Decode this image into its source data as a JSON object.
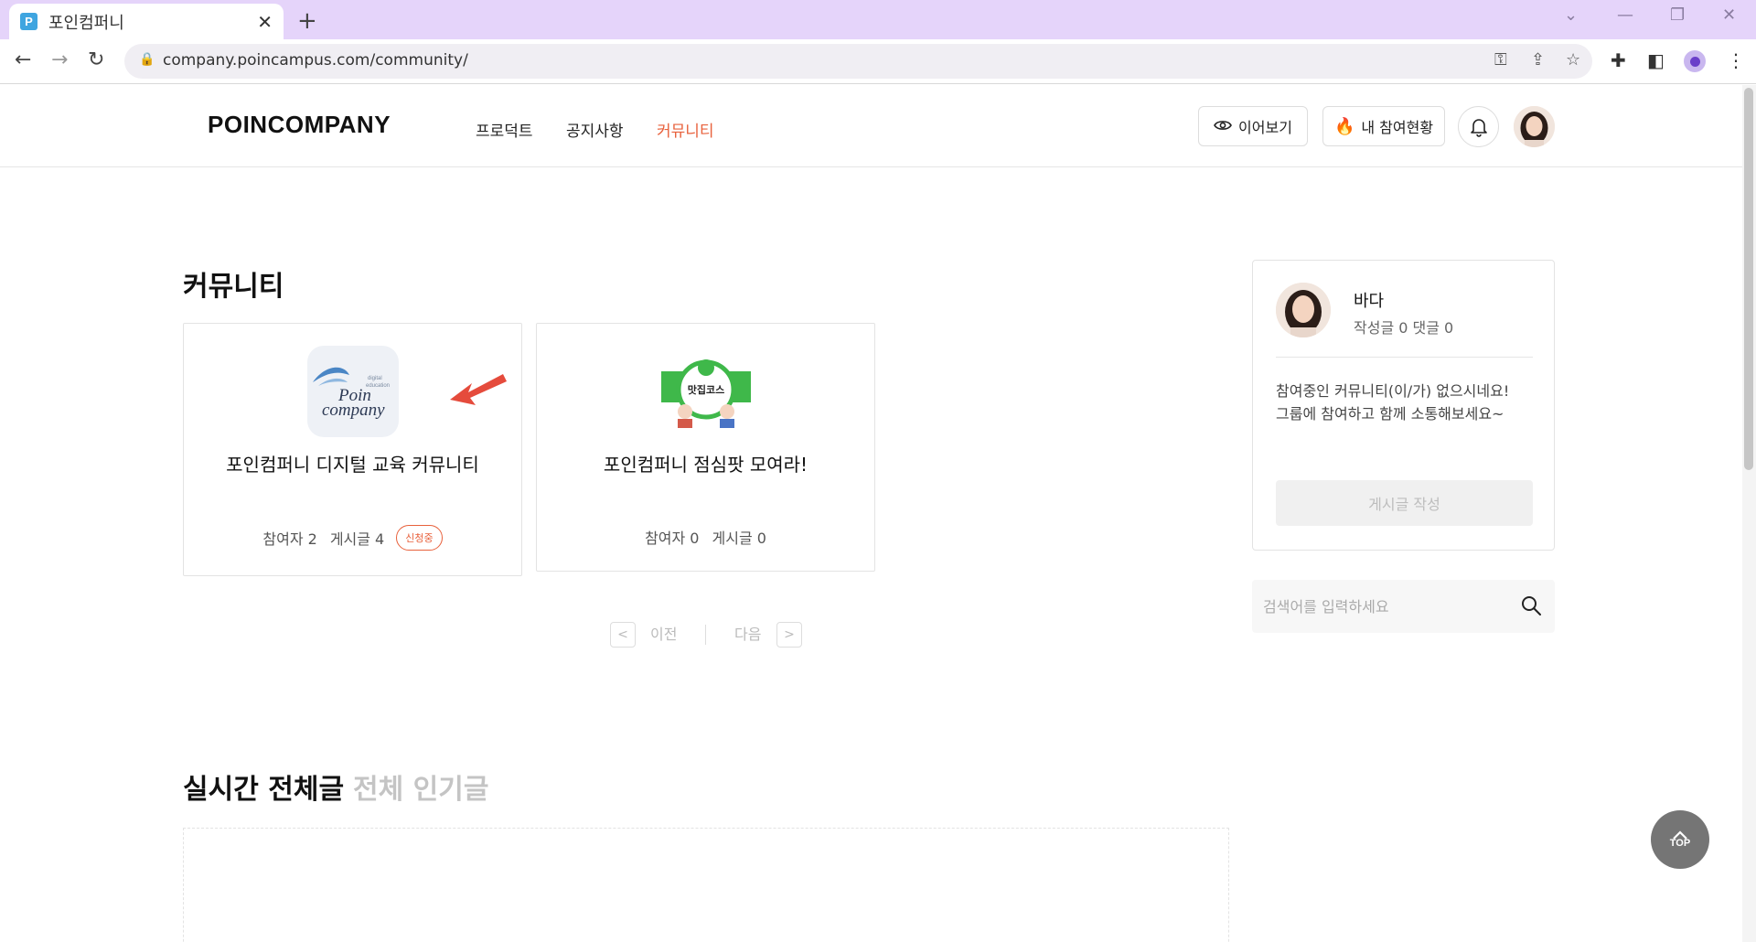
{
  "browser": {
    "tab_title": "포인컴퍼니",
    "favicon_letter": "P",
    "url": "company.poincampus.com/community/"
  },
  "header": {
    "logo": "POINCOMPANY",
    "nav": {
      "product": "프로덕트",
      "notice": "공지사항",
      "community": "커뮤니티"
    },
    "continue_label": "이어보기",
    "my_status_label": "내 참여현황"
  },
  "main": {
    "title": "커뮤니티",
    "cards": [
      {
        "title": "포인컴퍼니 디지털 교육 커뮤니티",
        "participants": "참여자 2",
        "posts": "게시글 4",
        "badge": "신청중",
        "logo_text_small": "digital education",
        "logo_text": "Poin company"
      },
      {
        "title": "포인컴퍼니 점심팟 모여라!",
        "participants": "참여자 0",
        "posts": "게시글 0",
        "logo_text": "맛집코스"
      }
    ],
    "pager": {
      "prev": "이전",
      "next": "다음"
    },
    "feed_tabs": {
      "realtime": "실시간 전체글",
      "popular": "전체 인기글"
    }
  },
  "side": {
    "user_name": "바다",
    "user_stats": "작성글 0 댓글 0",
    "message": "참여중인 커뮤니티(이/가) 없으시네요!\n그룹에 참여하고 함께 소통해보세요~",
    "write_button": "게시글 작성",
    "search_placeholder": "검색어를 입력하세요"
  },
  "top_button": "TOP",
  "colors": {
    "accent": "#e8613c",
    "tabstrip": "#e5d4fa"
  }
}
